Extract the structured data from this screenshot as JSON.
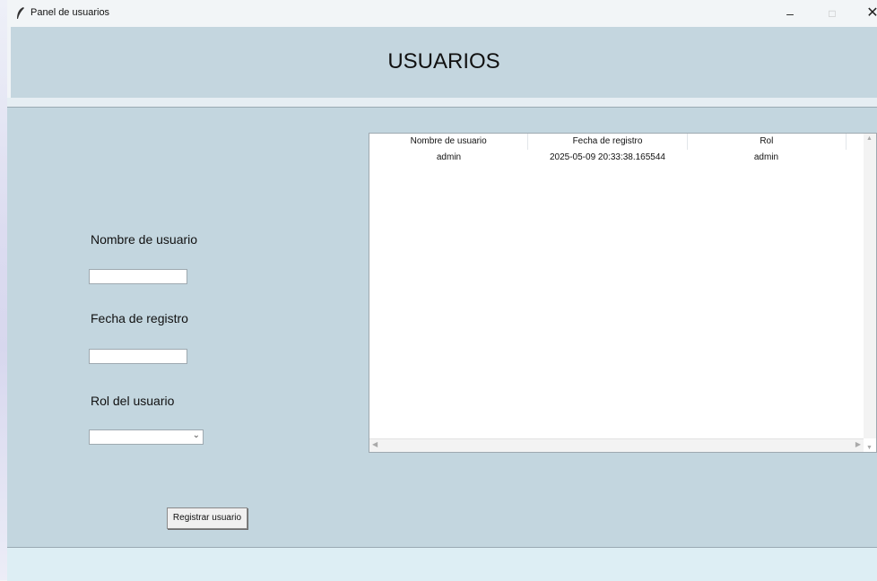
{
  "window": {
    "title": "Panel de usuarios",
    "minimize": "–",
    "maximize": "□",
    "close": "✕"
  },
  "header": {
    "title": "USUARIOS"
  },
  "form": {
    "username_label": "Nombre de usuario",
    "username_value": "",
    "date_label": "Fecha de registro",
    "date_value": "",
    "role_label": "Rol del usuario",
    "role_value": "",
    "submit_label": "Registrar usuario"
  },
  "table": {
    "columns": [
      "Nombre de usuario",
      "Fecha de registro",
      "Rol"
    ],
    "rows": [
      [
        "admin",
        "2025-05-09 20:33:38.165544",
        "admin"
      ]
    ]
  },
  "colors": {
    "panel": "#c3d6df",
    "footer": "#ddeef4"
  }
}
